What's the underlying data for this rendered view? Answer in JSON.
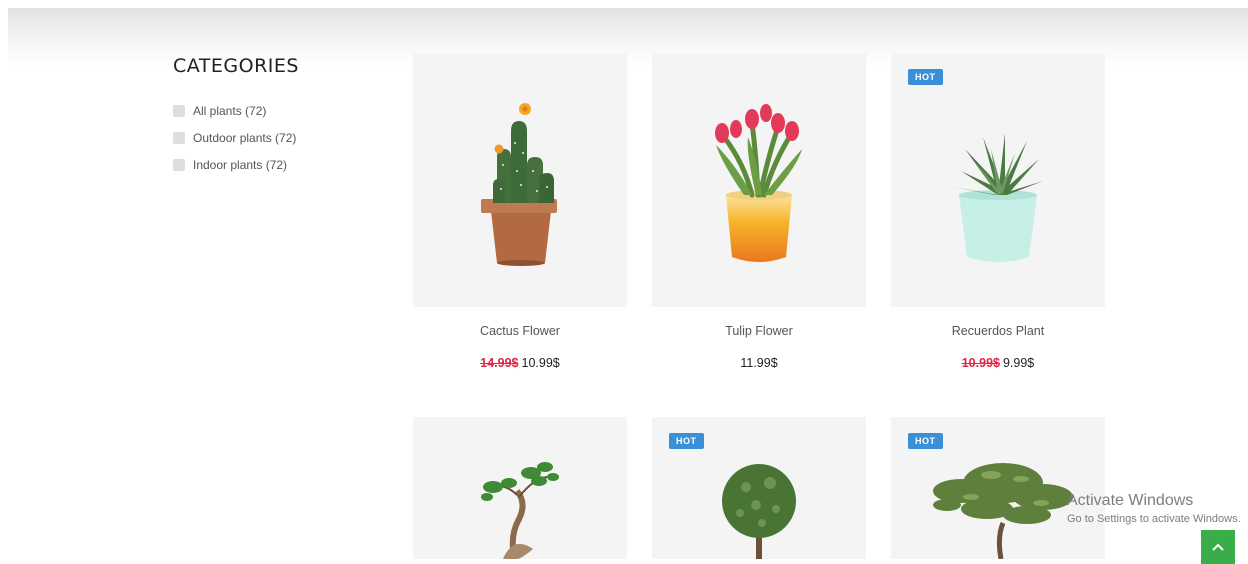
{
  "sidebar": {
    "title": "CATEGORIES",
    "items": [
      {
        "label": "All plants (72)"
      },
      {
        "label": "Outdoor plants (72)"
      },
      {
        "label": "Indoor plants (72)"
      }
    ]
  },
  "products": [
    {
      "name": "Cactus Flower",
      "old_price": "14.99$",
      "price": "10.99$",
      "badge": "",
      "icon": "cactus-flower-image"
    },
    {
      "name": "Tulip Flower",
      "old_price": "",
      "price": "11.99$",
      "badge": "",
      "icon": "tulip-flower-image"
    },
    {
      "name": "Recuerdos Plant",
      "old_price": "10.99$",
      "price": "9.99$",
      "badge": "HOT",
      "icon": "succulent-plant-image"
    },
    {
      "name": "",
      "old_price": "",
      "price": "",
      "badge": "",
      "icon": "bonsai-plant-image"
    },
    {
      "name": "",
      "old_price": "",
      "price": "",
      "badge": "HOT",
      "icon": "round-topiary-tree-image"
    },
    {
      "name": "",
      "old_price": "",
      "price": "",
      "badge": "HOT",
      "icon": "olive-tree-image"
    }
  ],
  "watermark": {
    "line1": "Activate Windows",
    "line2": "Go to Settings to activate Windows."
  },
  "colors": {
    "badge": "#3a8fd9",
    "sale_price": "#e0284a",
    "scroll_button": "#38ad48",
    "thumb_bg": "#f4f4f4"
  },
  "icons": {
    "scroll_top": "chevron-up-icon",
    "checkbox": "checkbox-icon"
  }
}
